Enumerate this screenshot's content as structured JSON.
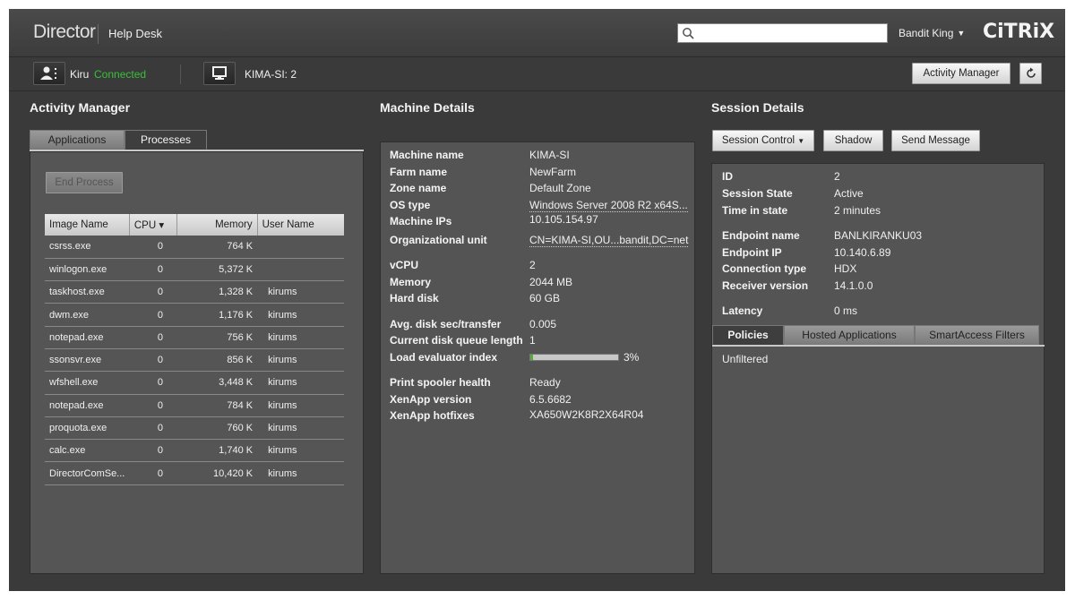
{
  "header": {
    "brand": "Director",
    "section": "Help Desk",
    "search_placeholder": "",
    "user": "Bandit King",
    "logo": "CiTRiX"
  },
  "sessionbar": {
    "user_name": "Kiru",
    "user_status": "Connected",
    "machine_label": "KIMA-SI: 2",
    "activity_manager_button": "Activity Manager",
    "refresh_icon": "refresh-icon"
  },
  "activity_manager": {
    "title": "Activity Manager",
    "tabs": [
      "Applications",
      "Processes"
    ],
    "active_tab": "Processes",
    "end_process_button": "End Process",
    "columns": [
      "Image Name",
      "CPU",
      "Memory",
      "User Name"
    ],
    "sort_indicator": "▾",
    "rows": [
      {
        "image": "csrss.exe",
        "cpu": "0",
        "memory": "764 K",
        "user": ""
      },
      {
        "image": "winlogon.exe",
        "cpu": "0",
        "memory": "5,372 K",
        "user": ""
      },
      {
        "image": "taskhost.exe",
        "cpu": "0",
        "memory": "1,328 K",
        "user": "kirums"
      },
      {
        "image": "dwm.exe",
        "cpu": "0",
        "memory": "1,176 K",
        "user": "kirums"
      },
      {
        "image": "notepad.exe",
        "cpu": "0",
        "memory": "756 K",
        "user": "kirums"
      },
      {
        "image": "ssonsvr.exe",
        "cpu": "0",
        "memory": "856 K",
        "user": "kirums"
      },
      {
        "image": "wfshell.exe",
        "cpu": "0",
        "memory": "3,448 K",
        "user": "kirums"
      },
      {
        "image": "notepad.exe",
        "cpu": "0",
        "memory": "784 K",
        "user": "kirums"
      },
      {
        "image": "proquota.exe",
        "cpu": "0",
        "memory": "760 K",
        "user": "kirums"
      },
      {
        "image": "calc.exe",
        "cpu": "0",
        "memory": "1,740 K",
        "user": "kirums"
      },
      {
        "image": "DirectorComSe...",
        "cpu": "0",
        "memory": "10,420 K",
        "user": "kirums"
      }
    ]
  },
  "machine_details": {
    "title": "Machine Details",
    "fields": {
      "machine_name": {
        "label": "Machine name",
        "value": "KIMA-SI"
      },
      "farm_name": {
        "label": "Farm name",
        "value": "NewFarm"
      },
      "zone_name": {
        "label": "Zone name",
        "value": "Default Zone"
      },
      "os_type": {
        "label": "OS type",
        "value": "Windows Server 2008 R2 x64S..."
      },
      "machine_ips": {
        "label": "Machine IPs",
        "value": "10.105.154.97"
      },
      "org_unit": {
        "label": "Organizational unit",
        "value": "CN=KIMA-SI,OU...bandit,DC=net"
      },
      "vcpu": {
        "label": "vCPU",
        "value": "2"
      },
      "memory": {
        "label": "Memory",
        "value": "2044 MB"
      },
      "hard_disk": {
        "label": "Hard disk",
        "value": "60 GB"
      },
      "disk_sec": {
        "label": "Avg. disk sec/transfer",
        "value": "0.005"
      },
      "disk_queue": {
        "label": "Current disk queue length",
        "value": "1"
      },
      "load_index": {
        "label": "Load evaluator index",
        "value": "3%",
        "fraction": 0.03
      },
      "spooler": {
        "label": "Print spooler health",
        "value": "Ready"
      },
      "xenapp_version": {
        "label": "XenApp version",
        "value": "6.5.6682"
      },
      "xenapp_hotfixes": {
        "label": "XenApp hotfixes",
        "value": "XA650W2K8R2X64R04"
      }
    }
  },
  "session_details": {
    "title": "Session Details",
    "session_control_button": "Session Control",
    "shadow_button": "Shadow",
    "send_message_button": "Send Message",
    "fields": {
      "id": {
        "label": "ID",
        "value": "2"
      },
      "state": {
        "label": "Session State",
        "value": "Active"
      },
      "time": {
        "label": "Time in state",
        "value": "2 minutes"
      },
      "endpoint_name": {
        "label": "Endpoint name",
        "value": "BANLKIRANKU03"
      },
      "endpoint_ip": {
        "label": "Endpoint IP",
        "value": "10.140.6.89"
      },
      "conn_type": {
        "label": "Connection type",
        "value": "HDX"
      },
      "receiver": {
        "label": "Receiver version",
        "value": "14.1.0.0"
      },
      "latency": {
        "label": "Latency",
        "value": "0 ms"
      }
    },
    "tabs": [
      "Policies",
      "Hosted Applications",
      "SmartAccess Filters"
    ],
    "active_tab": "Policies",
    "policies_text": "Unfiltered"
  }
}
